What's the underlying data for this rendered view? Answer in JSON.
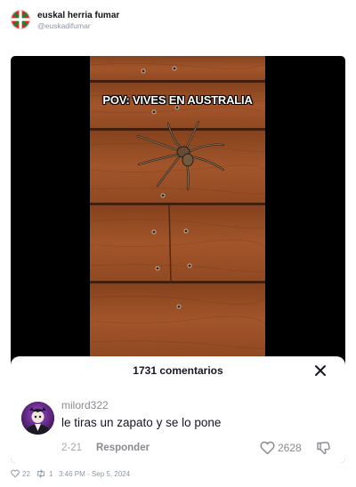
{
  "post": {
    "author_name": "euskal herria fumar",
    "author_handle": "@euskadifumar",
    "likes": "22",
    "reposts": "1",
    "timestamp": "3:46 PM - Sep 5, 2024"
  },
  "video": {
    "overlay_text": "POV: VIVES EN AUSTRALIA"
  },
  "comments_panel": {
    "count_label": "1731 comentarios",
    "comment": {
      "username": "milord322",
      "text": "le tiras un zapato y se lo pone",
      "date": "2-21",
      "reply_label": "Responder",
      "like_count": "2628"
    }
  },
  "colors": {
    "wood_base": "#a4552a",
    "wood_dark": "#5a2a12",
    "video_background": "#000000",
    "sheet_background": "#ffffff",
    "muted_text": "#8a8b91"
  }
}
